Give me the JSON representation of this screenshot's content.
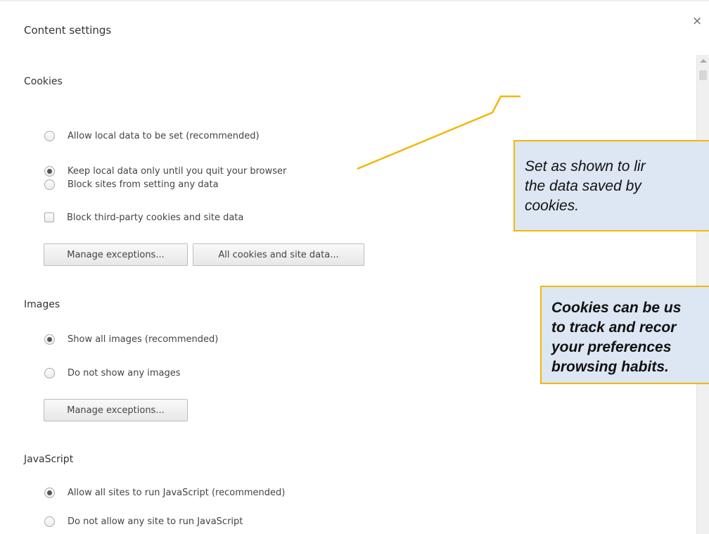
{
  "dialog": {
    "title": "Content settings",
    "close_label": "×"
  },
  "cookies": {
    "heading": "Cookies",
    "options": [
      {
        "label": "Allow local data to be set (recommended)",
        "checked": false
      },
      {
        "label": "Keep local data only until you quit your browser",
        "checked": true
      },
      {
        "label": "Block sites from setting any data",
        "checked": false
      }
    ],
    "third_party": {
      "label": "Block third-party cookies and site data",
      "checked": false
    },
    "manage_exceptions_label": "Manage exceptions...",
    "all_cookies_label": "All cookies and site data..."
  },
  "images": {
    "heading": "Images",
    "options": [
      {
        "label": "Show all images (recommended)",
        "checked": true
      },
      {
        "label": "Do not show any images",
        "checked": false
      }
    ],
    "manage_exceptions_label": "Manage exceptions..."
  },
  "javascript": {
    "heading": "JavaScript",
    "options": [
      {
        "label": "Allow all sites to run JavaScript (recommended)",
        "checked": true
      },
      {
        "label": "Do not allow any site to run JavaScript",
        "checked": false
      }
    ]
  },
  "callouts": {
    "first": {
      "line1": "Set as shown to lir",
      "line2": "the data saved by",
      "line3": "cookies."
    },
    "second": {
      "line1": "Cookies can be us",
      "line2": "to track and recor",
      "line3": "your preferences",
      "line4": "browsing habits."
    }
  },
  "colors": {
    "callout_border": "#f2b705",
    "callout_fill": "#dde6f3"
  }
}
